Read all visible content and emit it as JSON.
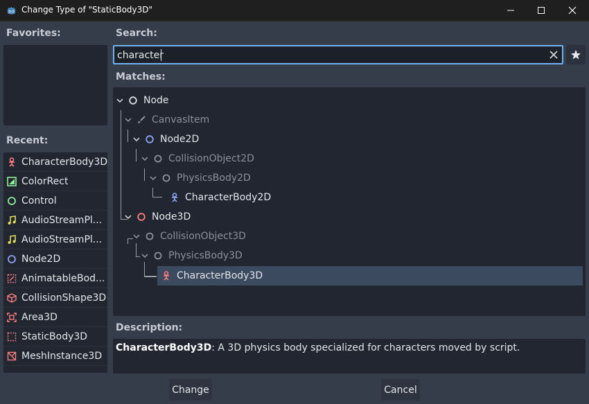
{
  "window": {
    "title": "Change Type of \"StaticBody3D\"",
    "minimize_icon": "minimize-icon",
    "maximize_icon": "maximize-icon",
    "close_icon": "close-icon"
  },
  "favorites": {
    "label": "Favorites:",
    "items": []
  },
  "recent": {
    "label": "Recent:",
    "items": [
      {
        "label": "CharacterBody3D",
        "icon": "characterbody3d-icon",
        "color": "#fc7f7f"
      },
      {
        "label": "ColorRect",
        "icon": "colorrect-icon",
        "color": "#8eef97"
      },
      {
        "label": "Control",
        "icon": "control-icon",
        "color": "#8eef97"
      },
      {
        "label": "AudioStreamPl...",
        "icon": "audio-icon",
        "color": "#e1da5b"
      },
      {
        "label": "AudioStreamPl...",
        "icon": "audio-icon",
        "color": "#e1da5b"
      },
      {
        "label": "Node2D",
        "icon": "node2d-icon",
        "color": "#8da5f3"
      },
      {
        "label": "AnimatableBod...",
        "icon": "animatablebody-icon",
        "color": "#fc7f7f"
      },
      {
        "label": "CollisionShape3D",
        "icon": "collisionshape3d-icon",
        "color": "#fc7f7f"
      },
      {
        "label": "Area3D",
        "icon": "area3d-icon",
        "color": "#fc7f7f"
      },
      {
        "label": "StaticBody3D",
        "icon": "staticbody3d-icon",
        "color": "#fc7f7f"
      },
      {
        "label": "MeshInstance3D",
        "icon": "meshinstance3d-icon",
        "color": "#fc7f7f"
      }
    ]
  },
  "search": {
    "label": "Search:",
    "value": "character",
    "clear_icon": "clear-icon",
    "favorite_icon": "star-icon"
  },
  "matches": {
    "label": "Matches:",
    "nodes": [
      {
        "label": "Node",
        "icon": "node-icon",
        "color": "#e0e0e0",
        "dim": false
      },
      {
        "label": "CanvasItem",
        "icon": "canvasitem-icon",
        "color": "#8a9099",
        "dim": true
      },
      {
        "label": "Node2D",
        "icon": "node2d-icon",
        "color": "#8da5f3",
        "dim": false
      },
      {
        "label": "CollisionObject2D",
        "icon": "collisionobject2d-icon",
        "color": "#8a9099",
        "dim": true
      },
      {
        "label": "PhysicsBody2D",
        "icon": "physicsbody2d-icon",
        "color": "#8a9099",
        "dim": true
      },
      {
        "label": "CharacterBody2D",
        "icon": "characterbody2d-icon",
        "color": "#8da5f3",
        "dim": false
      },
      {
        "label": "Node3D",
        "icon": "node3d-icon",
        "color": "#fc7f7f",
        "dim": false
      },
      {
        "label": "CollisionObject3D",
        "icon": "collisionobject3d-icon",
        "color": "#8a9099",
        "dim": true
      },
      {
        "label": "PhysicsBody3D",
        "icon": "physicsbody3d-icon",
        "color": "#8a9099",
        "dim": true
      },
      {
        "label": "CharacterBody3D",
        "icon": "characterbody3d-icon",
        "color": "#fc7f7f",
        "dim": false,
        "selected": true
      }
    ]
  },
  "description": {
    "label": "Description:",
    "class_name": "CharacterBody3D",
    "text": ": A 3D physics body specialized for characters moved by script."
  },
  "buttons": {
    "change": "Change",
    "cancel": "Cancel"
  },
  "colors": {
    "accent": "#6fb3f7",
    "selection": "#3b4a5f",
    "background": "#363d4a",
    "panel": "#212630"
  }
}
